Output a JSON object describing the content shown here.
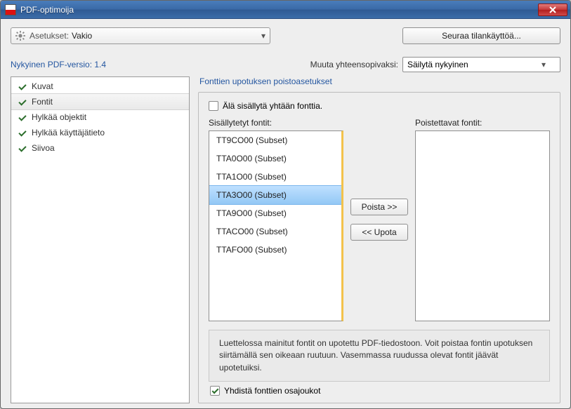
{
  "window": {
    "title": "PDF-optimoija",
    "close_icon": "close-icon"
  },
  "toolbar": {
    "settings_label": "Asetukset:",
    "settings_value": "Vakio",
    "track_usage_button": "Seuraa tilankäyttöä..."
  },
  "version_row": {
    "current_version_label": "Nykyinen PDF-versio:",
    "current_version_value": "1.4",
    "compat_label": "Muuta yhteensopivaksi:",
    "compat_value": "Säilytä nykyinen"
  },
  "sidebar": {
    "items": [
      {
        "label": "Kuvat",
        "checked": true,
        "selected": false
      },
      {
        "label": "Fontit",
        "checked": true,
        "selected": true
      },
      {
        "label": "Hylkää objektit",
        "checked": true,
        "selected": false
      },
      {
        "label": "Hylkää käyttäjätieto",
        "checked": true,
        "selected": false
      },
      {
        "label": "Siivoa",
        "checked": true,
        "selected": false
      }
    ]
  },
  "panel": {
    "group_title": "Fonttien upotuksen poistoasetukset",
    "no_fonts_checkbox_label": "Älä sisällytä yhtään fonttia.",
    "embedded_list_title": "Sisällytetyt fontit:",
    "removable_list_title": "Poistettavat fontit:",
    "embedded_fonts": [
      {
        "name": "TT9CO00 (Subset)",
        "selected": false
      },
      {
        "name": "TTA0O00 (Subset)",
        "selected": false
      },
      {
        "name": "TTA1O00 (Subset)",
        "selected": false
      },
      {
        "name": "TTA3O00 (Subset)",
        "selected": true
      },
      {
        "name": "TTA9O00 (Subset)",
        "selected": false
      },
      {
        "name": "TTACO00 (Subset)",
        "selected": false
      },
      {
        "name": "TTAFO00 (Subset)",
        "selected": false
      }
    ],
    "removable_fonts": [],
    "remove_button": "Poista >>",
    "embed_button": "<< Upota",
    "hint_text": "Luettelossa mainitut fontit on upotettu PDF-tiedostoon. Voit poistaa fontin upotuksen siirtämällä sen oikeaan ruutuun. Vasemmassa ruudussa olevat fontit jäävät upotetuiksi.",
    "merge_subsets_label": "Yhdistä fonttien osajoukot",
    "merge_subsets_checked": true
  }
}
